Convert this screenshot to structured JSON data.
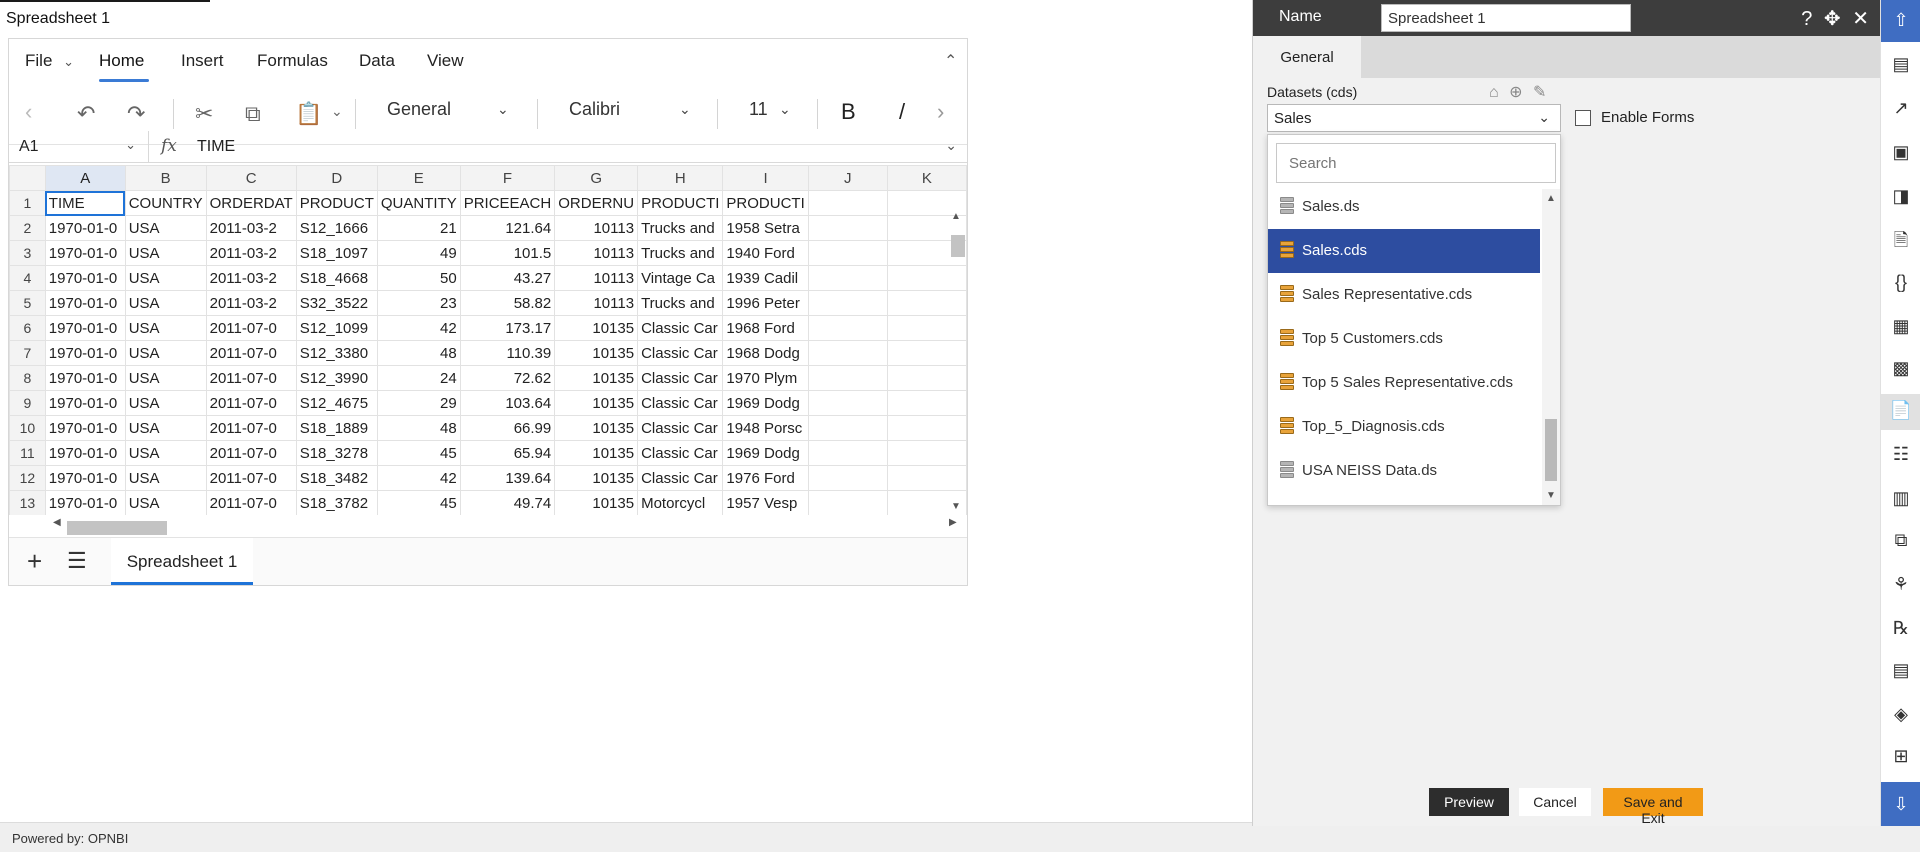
{
  "document": {
    "title": "Spreadsheet 1"
  },
  "ribbon": {
    "menu": [
      "File",
      "Home",
      "Insert",
      "Formulas",
      "Data",
      "View"
    ],
    "number_format": "General",
    "font_name": "Calibri",
    "font_size": "11",
    "bold_label": "B",
    "italic_label": "/"
  },
  "formula_bar": {
    "cell_ref": "A1",
    "fx_label": "fx",
    "value": "TIME"
  },
  "grid": {
    "columns": [
      "A",
      "B",
      "C",
      "D",
      "E",
      "F",
      "G",
      "H",
      "I",
      "J",
      "K"
    ],
    "rows": [
      [
        "1",
        "TIME",
        "COUNTRY",
        "ORDERDAT",
        "PRODUCT",
        "QUANTITY",
        "PRICEEACH",
        "ORDERNU",
        "PRODUCTI",
        "PRODUCTI",
        "",
        ""
      ],
      [
        "2",
        "1970-01-0",
        "USA",
        "2011-03-2",
        "S12_1666",
        "21",
        "121.64",
        "10113",
        "Trucks and",
        "1958 Setra",
        "",
        ""
      ],
      [
        "3",
        "1970-01-0",
        "USA",
        "2011-03-2",
        "S18_1097",
        "49",
        "101.5",
        "10113",
        "Trucks and",
        "1940 Ford",
        "",
        ""
      ],
      [
        "4",
        "1970-01-0",
        "USA",
        "2011-03-2",
        "S18_4668",
        "50",
        "43.27",
        "10113",
        "Vintage Ca",
        "1939 Cadil",
        "",
        ""
      ],
      [
        "5",
        "1970-01-0",
        "USA",
        "2011-03-2",
        "S32_3522",
        "23",
        "58.82",
        "10113",
        "Trucks and",
        "1996 Peter",
        "",
        ""
      ],
      [
        "6",
        "1970-01-0",
        "USA",
        "2011-07-0",
        "S12_1099",
        "42",
        "173.17",
        "10135",
        "Classic Car",
        "1968 Ford",
        "",
        ""
      ],
      [
        "7",
        "1970-01-0",
        "USA",
        "2011-07-0",
        "S12_3380",
        "48",
        "110.39",
        "10135",
        "Classic Car",
        "1968 Dodg",
        "",
        ""
      ],
      [
        "8",
        "1970-01-0",
        "USA",
        "2011-07-0",
        "S12_3990",
        "24",
        "72.62",
        "10135",
        "Classic Car",
        "1970 Plym",
        "",
        ""
      ],
      [
        "9",
        "1970-01-0",
        "USA",
        "2011-07-0",
        "S12_4675",
        "29",
        "103.64",
        "10135",
        "Classic Car",
        "1969 Dodg",
        "",
        ""
      ],
      [
        "10",
        "1970-01-0",
        "USA",
        "2011-07-0",
        "S18_1889",
        "48",
        "66.99",
        "10135",
        "Classic Car",
        "1948 Porsc",
        "",
        ""
      ],
      [
        "11",
        "1970-01-0",
        "USA",
        "2011-07-0",
        "S18_3278",
        "45",
        "65.94",
        "10135",
        "Classic Car",
        "1969 Dodg",
        "",
        ""
      ],
      [
        "12",
        "1970-01-0",
        "USA",
        "2011-07-0",
        "S18_3482",
        "42",
        "139.64",
        "10135",
        "Classic Car",
        "1976 Ford",
        "",
        ""
      ],
      [
        "13",
        "1970-01-0",
        "USA",
        "2011-07-0",
        "S18_3782",
        "45",
        "49.74",
        "10135",
        "Motorcycl",
        "1957 Vesp",
        "",
        ""
      ]
    ]
  },
  "sheet_tabs": {
    "active": "Spreadsheet 1"
  },
  "footer": {
    "text": "Powered by: OPNBI"
  },
  "panel": {
    "name_label": "Name",
    "name_value": "Spreadsheet 1",
    "tab_general": "General",
    "datasets_label": "Datasets (cds)",
    "selected_dataset": "Sales",
    "enable_forms_label": "Enable Forms",
    "search_placeholder": "Search",
    "dataset_options": [
      {
        "label": "Sales.ds",
        "kind": "ds",
        "selected": false
      },
      {
        "label": "Sales.cds",
        "kind": "cds",
        "selected": true
      },
      {
        "label": "Sales Representative.cds",
        "kind": "cds",
        "selected": false
      },
      {
        "label": "Top 5 Customers.cds",
        "kind": "cds",
        "selected": false
      },
      {
        "label": "Top 5 Sales Representative.cds",
        "kind": "cds",
        "selected": false
      },
      {
        "label": "Top_5_Diagnosis.cds",
        "kind": "cds",
        "selected": false
      },
      {
        "label": "USA NEISS Data.ds",
        "kind": "ds",
        "selected": false
      }
    ],
    "buttons": {
      "preview": "Preview",
      "cancel": "Cancel",
      "save_exit": "Save and Exit"
    }
  },
  "colors": {
    "selection_blue": "#2d4da0",
    "save_orange": "#f29a16",
    "rail_blue": "#3f6dc2",
    "header_dark": "#3d3d3d",
    "cds_icon": "#e8a33a",
    "ds_icon": "#b5b5b5"
  }
}
